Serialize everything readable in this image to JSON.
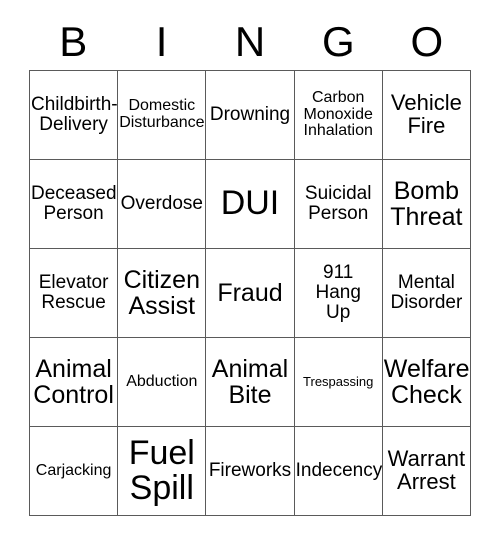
{
  "card": {
    "header_letters": [
      "B",
      "I",
      "N",
      "G",
      "O"
    ],
    "columns": 5,
    "rows": 5,
    "border_color": "#5a5a5a",
    "background_color": "#ffffff",
    "text_color": "#000000",
    "cells": [
      {
        "text": "Childbirth-\nDelivery",
        "size": "md"
      },
      {
        "text": "Domestic\nDisturbance",
        "size": "sm"
      },
      {
        "text": "Drowning",
        "size": "md"
      },
      {
        "text": "Carbon\nMonoxide\nInhalation",
        "size": "sm"
      },
      {
        "text": "Vehicle\nFire",
        "size": "lg"
      },
      {
        "text": "Deceased\nPerson",
        "size": "md"
      },
      {
        "text": "Overdose",
        "size": "md"
      },
      {
        "text": "DUI",
        "size": "xxl"
      },
      {
        "text": "Suicidal\nPerson",
        "size": "md"
      },
      {
        "text": "Bomb\nThreat",
        "size": "xl"
      },
      {
        "text": "Elevator\nRescue",
        "size": "md"
      },
      {
        "text": "Citizen\nAssist",
        "size": "xl"
      },
      {
        "text": "Fraud",
        "size": "xl"
      },
      {
        "text": "911\nHang\nUp",
        "size": "md"
      },
      {
        "text": "Mental\nDisorder",
        "size": "md"
      },
      {
        "text": "Animal\nControl",
        "size": "xl"
      },
      {
        "text": "Abduction",
        "size": "sm"
      },
      {
        "text": "Animal\nBite",
        "size": "xl"
      },
      {
        "text": "Trespassing",
        "size": "xs"
      },
      {
        "text": "Welfare\nCheck",
        "size": "xl"
      },
      {
        "text": "Carjacking",
        "size": "sm"
      },
      {
        "text": "Fuel\nSpill",
        "size": "xxl"
      },
      {
        "text": "Fireworks",
        "size": "md"
      },
      {
        "text": "Indecency",
        "size": "md"
      },
      {
        "text": "Warrant\nArrest",
        "size": "lg"
      }
    ]
  }
}
